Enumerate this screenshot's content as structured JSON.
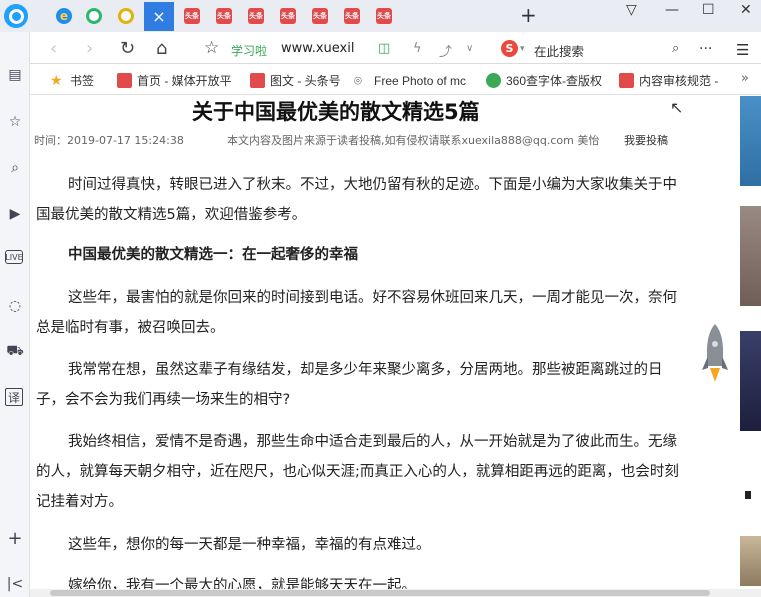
{
  "tabs": [
    {
      "favicon": "ie-icon",
      "label": "e"
    },
    {
      "favicon": "green-ring-icon"
    },
    {
      "favicon": "yellow-ring-icon"
    },
    {
      "active": true,
      "close": "×"
    },
    {
      "favicon": "toutiao-icon",
      "label": "头条"
    },
    {
      "favicon": "toutiao-icon",
      "label": "头条"
    },
    {
      "favicon": "toutiao-icon",
      "label": "头条"
    },
    {
      "favicon": "toutiao-icon",
      "label": "头条"
    },
    {
      "favicon": "toutiao-icon",
      "label": "头条"
    },
    {
      "favicon": "toutiao-icon",
      "label": "头条"
    },
    {
      "favicon": "toutiao-icon",
      "label": "头条"
    }
  ],
  "new_tab": "+",
  "window": {
    "minimize": "—",
    "maximize": "☐",
    "close": "✕"
  },
  "address": {
    "site_name": "学习啦",
    "url": "www.xuexil",
    "search_engine": "S",
    "search_placeholder": "在此搜索",
    "more": "···",
    "menu": "☰"
  },
  "bookmarks": [
    {
      "label": "书签",
      "icon": "star-icon"
    },
    {
      "label": "首页 - 媒体开放平",
      "icon": "toutiao-icon"
    },
    {
      "label": "图文 - 头条号",
      "icon": "toutiao-icon"
    },
    {
      "label": "Free Photo of mc",
      "icon": "camera-icon"
    },
    {
      "label": "360查字体-查版权",
      "icon": "360-icon"
    },
    {
      "label": "内容审核规范 - ",
      "icon": "toutiao-icon"
    }
  ],
  "bookmark_more": "»",
  "article": {
    "title": "关于中国最优美的散文精选5篇",
    "time": "时间：2019-07-17 15:24:38",
    "copyright": "本文内容及图片来源于读者投稿,如有侵权请联系xuexila888@qq.com 美怡",
    "submit": "我要投稿",
    "paragraphs": [
      {
        "text": "时间过得真快，转眼已进入了秋末。不过，大地仍留有秋的足迹。下面是小编为大家收集关于中国最优美的散文精选5篇，欢迎借鉴参考。",
        "bold": false
      },
      {
        "text": "中国最优美的散文精选一：在一起奢侈的幸福",
        "bold": true
      },
      {
        "text": "这些年，最害怕的就是你回来的时间接到电话。好不容易休班回来几天，一周才能见一次，奈何总是临时有事，被召唤回去。",
        "bold": false
      },
      {
        "text": "我常常在想，虽然这辈子有缘结发，却是多少年来聚少离多，分居两地。那些被距离跳过的日子，会不会为我们再续一场来生的相守?",
        "bold": false
      },
      {
        "text": "我始终相信，爱情不是奇遇，那些生命中适合走到最后的人，从一开始就是为了彼此而生。无缘的人，就算每天朝夕相守，近在咫尺，也心似天涯;而真正入心的人，就算相距再远的距离，也会时刻记挂着对方。",
        "bold": false
      },
      {
        "text": "这些年，想你的每一天都是一种幸福，幸福的有点难过。",
        "bold": false
      },
      {
        "text": "嫁给你，我有一个最大的心愿，就是能够天天在一起。",
        "bold": false
      }
    ]
  },
  "colors": {
    "accent": "#2f7de1",
    "tab_bar": "#e9edf3",
    "site_green": "#3aa856",
    "search_red": "#e94a3b"
  }
}
